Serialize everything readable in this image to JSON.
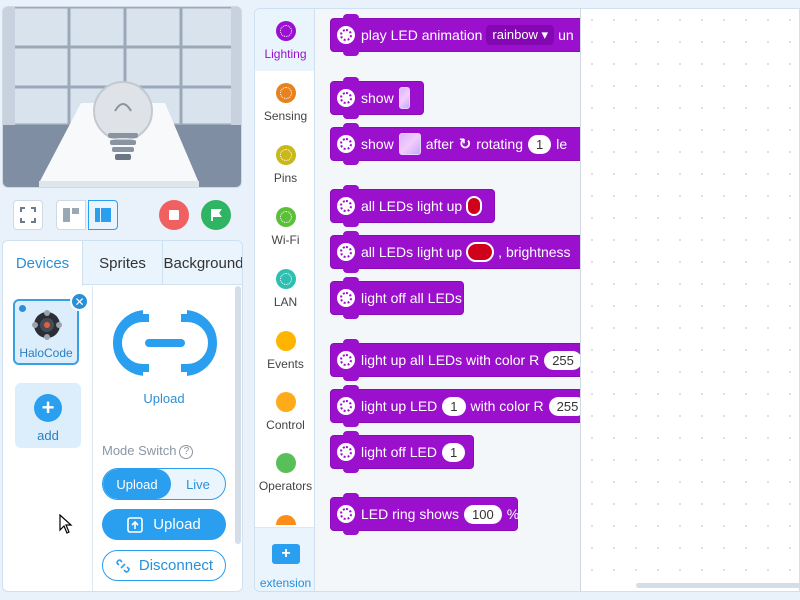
{
  "stage": {
    "scene": "lightbulb-on-desk",
    "controls": [
      "fullscreen-icon",
      "small-stage-icon",
      "large-stage-icon",
      "stop-icon",
      "green-flag-icon"
    ]
  },
  "left_panel": {
    "tabs": [
      {
        "label": "Devices",
        "active": true
      },
      {
        "label": "Sprites",
        "active": false
      },
      {
        "label": "Background",
        "active": false
      }
    ],
    "device": {
      "name": "HaloCode",
      "close_icon": "✕"
    },
    "add": {
      "label": "add",
      "icon": "+"
    },
    "upload_big_label": "Upload",
    "mode_switch_label": "Mode Switch",
    "mode_help": "?",
    "mode_options": {
      "upload": "Upload",
      "live": "Live"
    },
    "upload_button": "Upload",
    "disconnect_button": "Disconnect"
  },
  "categories": [
    {
      "label": "Lighting",
      "color": "#9b0fd0",
      "active": true
    },
    {
      "label": "Sensing",
      "color": "#e8821e"
    },
    {
      "label": "Pins",
      "color": "#c8b81a"
    },
    {
      "label": "Wi-Fi",
      "color": "#5cbf3a"
    },
    {
      "label": "LAN",
      "color": "#2ebfb0"
    },
    {
      "label": "Events",
      "color": "#ffb400"
    },
    {
      "label": "Control",
      "color": "#ffab19"
    },
    {
      "label": "Operators",
      "color": "#59c059"
    }
  ],
  "extension_label": "extension",
  "blocks": {
    "b1": {
      "text": "play LED animation",
      "dropdown": "rainbow ▾",
      "tail": "un"
    },
    "b2": {
      "text": "show"
    },
    "b3": {
      "text": "show",
      "after": "after",
      "rotating": "rotating",
      "value": "1",
      "tail": "le"
    },
    "b4": {
      "text": "all LEDs light up"
    },
    "b5": {
      "text": "all LEDs light up",
      "tail": ", brightness"
    },
    "b6": {
      "text": "light off all LEDs"
    },
    "b7": {
      "text": "light up all LEDs with color R",
      "value": "255"
    },
    "b8": {
      "text": "light up LED",
      "value": "1",
      "mid": "with color R",
      "value2": "255"
    },
    "b9": {
      "text": "light off LED",
      "value": "1"
    },
    "b10": {
      "text": "LED ring shows",
      "value": "100",
      "tail": "%"
    }
  }
}
